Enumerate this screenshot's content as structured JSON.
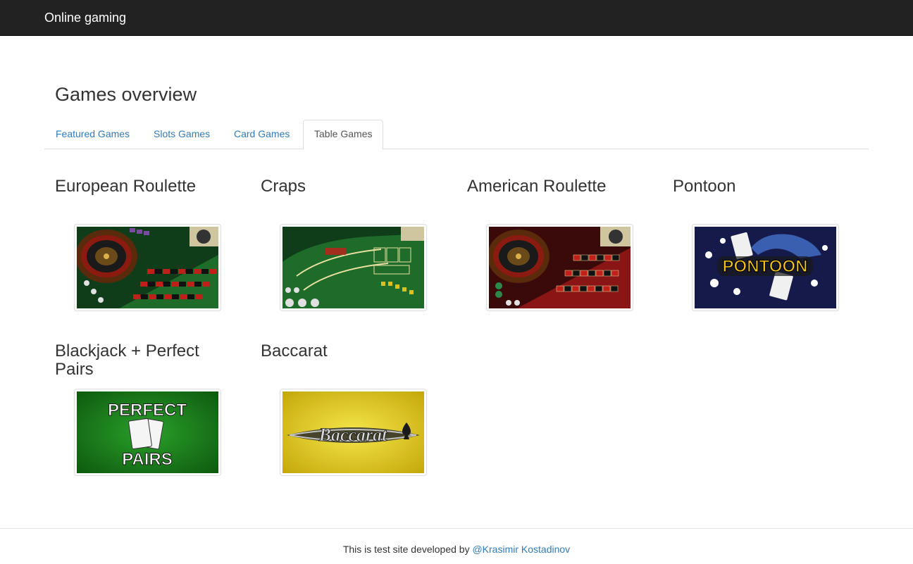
{
  "navbar": {
    "brand": "Online gaming"
  },
  "page": {
    "title": "Games overview"
  },
  "tabs": [
    {
      "label": "Featured Games",
      "active": false
    },
    {
      "label": "Slots Games",
      "active": false
    },
    {
      "label": "Card Games",
      "active": false
    },
    {
      "label": "Table Games",
      "active": true
    }
  ],
  "games": [
    {
      "title": "European Roulette",
      "image_text": ""
    },
    {
      "title": "Craps",
      "image_text": ""
    },
    {
      "title": "American Roulette",
      "image_text": ""
    },
    {
      "title": "Pontoon",
      "image_text": "PONTOON"
    },
    {
      "title": "Blackjack + Perfect Pairs",
      "image_text": "PERFECT PAIRS"
    },
    {
      "title": "Baccarat",
      "image_text": "Baccarat"
    }
  ],
  "footer": {
    "text": "This is test site developed by ",
    "link": "@Krasimir Kostadinov"
  },
  "colors": {
    "navbar_bg": "#222222",
    "link": "#337ab7",
    "table_felt": "#1f6b2a",
    "perfect_pairs_green": "#1a7a1a",
    "baccarat_gold": "#d9c21a",
    "pontoon_navy": "#151a4a"
  }
}
